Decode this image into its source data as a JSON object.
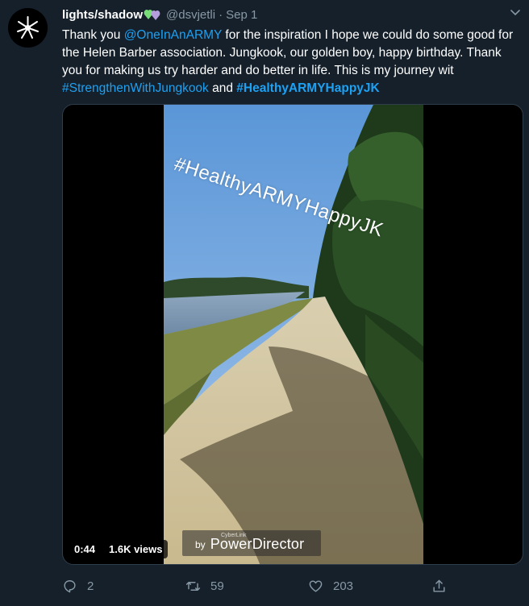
{
  "tweet": {
    "display_name": "lights/shadow",
    "handle": "@dsvjetli",
    "separator": "·",
    "date": "Sep 1",
    "text": {
      "part1": "Thank you ",
      "mention": "@OneInAnARMY",
      "part2": " for the inspiration I hope we could do some good for the Helen Barber association. Jungkook, our golden boy,  happy birthday. Thank you for making us try harder and do better in life. This is my journey wit ",
      "hashtag1": "#StrengthenWithJungkook",
      "part3": " and ",
      "hashtag2": "#HealthyARMYHappyJK"
    }
  },
  "media": {
    "overlay_text": "#HealthyARMYHappyJK",
    "watermark": {
      "by": "by",
      "brand": "CyberLink",
      "product": "PowerDirector"
    },
    "duration": "0:44",
    "views": "1.6K views"
  },
  "actions": {
    "replies": "2",
    "retweets": "59",
    "likes": "203"
  },
  "colors": {
    "background": "#15202b",
    "link": "#1da1f2",
    "muted": "#8899a6"
  },
  "icons": {
    "avatar": "white-flower-logo",
    "emoji": "green-purple-hearts",
    "caret": "chevron-down-icon",
    "reply": "reply-icon",
    "retweet": "retweet-icon",
    "like": "heart-icon",
    "share": "share-icon"
  }
}
